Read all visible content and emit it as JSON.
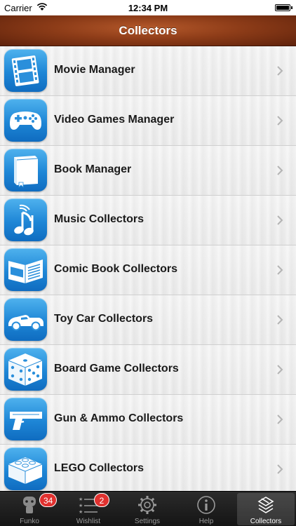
{
  "status_bar": {
    "carrier": "Carrier",
    "time": "12:34 PM"
  },
  "nav": {
    "title": "Collectors"
  },
  "colors": {
    "nav_brown": "#8d3c18",
    "icon_blue": "#1e86d6",
    "badge_red": "#e0312f"
  },
  "list": {
    "items": [
      {
        "label": "Movie Manager",
        "icon": "film-icon"
      },
      {
        "label": "Video Games Manager",
        "icon": "gamepad-icon"
      },
      {
        "label": "Book Manager",
        "icon": "book-icon"
      },
      {
        "label": "Music Collectors",
        "icon": "music-note-icon"
      },
      {
        "label": "Comic Book Collectors",
        "icon": "comic-book-icon"
      },
      {
        "label": "Toy Car Collectors",
        "icon": "toy-car-icon"
      },
      {
        "label": "Board Game Collectors",
        "icon": "dice-icon"
      },
      {
        "label": "Gun & Ammo Collectors",
        "icon": "pistol-icon"
      },
      {
        "label": "LEGO Collectors",
        "icon": "lego-brick-icon"
      }
    ]
  },
  "tabbar": {
    "tabs": [
      {
        "label": "Funko",
        "icon": "funko-figure-icon",
        "badge": "34"
      },
      {
        "label": "Wishlist",
        "icon": "star-list-icon",
        "badge": "2"
      },
      {
        "label": "Settings",
        "icon": "gear-icon",
        "badge": ""
      },
      {
        "label": "Help",
        "icon": "info-icon",
        "badge": ""
      },
      {
        "label": "Collectors",
        "icon": "collectors-stack-icon",
        "badge": "",
        "active": true
      }
    ]
  }
}
